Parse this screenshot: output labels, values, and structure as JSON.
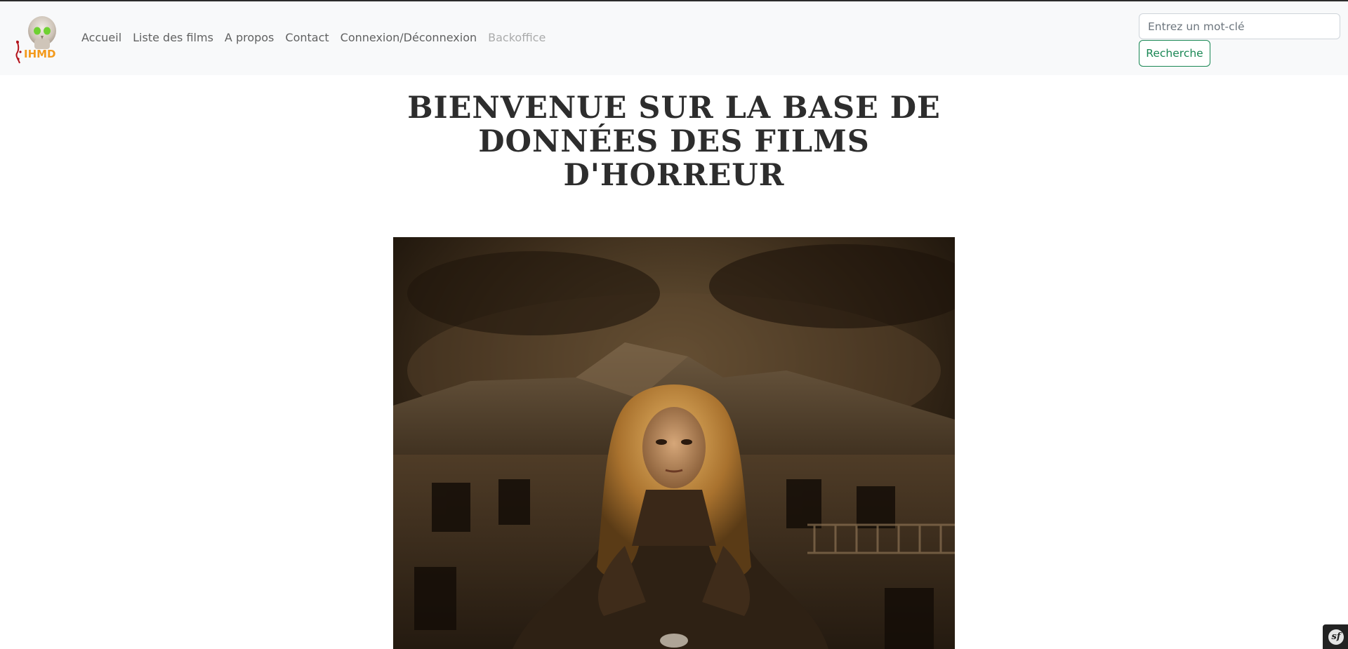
{
  "brand": {
    "logo_text": "IHMD",
    "logo_icon": "skull-logo-icon",
    "colors": {
      "skull": "#d7cfc6",
      "eyes": "#7bd83a",
      "text": "#f39a1c",
      "blood": "#b3121a"
    }
  },
  "nav": {
    "items": [
      {
        "label": "Accueil"
      },
      {
        "label": "Liste des films"
      },
      {
        "label": "A propos"
      },
      {
        "label": "Contact"
      },
      {
        "label": "Connexion/Déconnexion"
      },
      {
        "label": "Backoffice"
      }
    ]
  },
  "search": {
    "placeholder": "Entrez un mot-clé",
    "value": "",
    "button_label": "Recherche"
  },
  "main": {
    "title": "BIENVENUE SUR LA BASE DE DONNÉES DES FILMS D'HORREUR",
    "hero_image": "horror-woman-haunted-house-image"
  },
  "debug_toolbar": {
    "icon": "symfony-icon",
    "label": "sf"
  }
}
